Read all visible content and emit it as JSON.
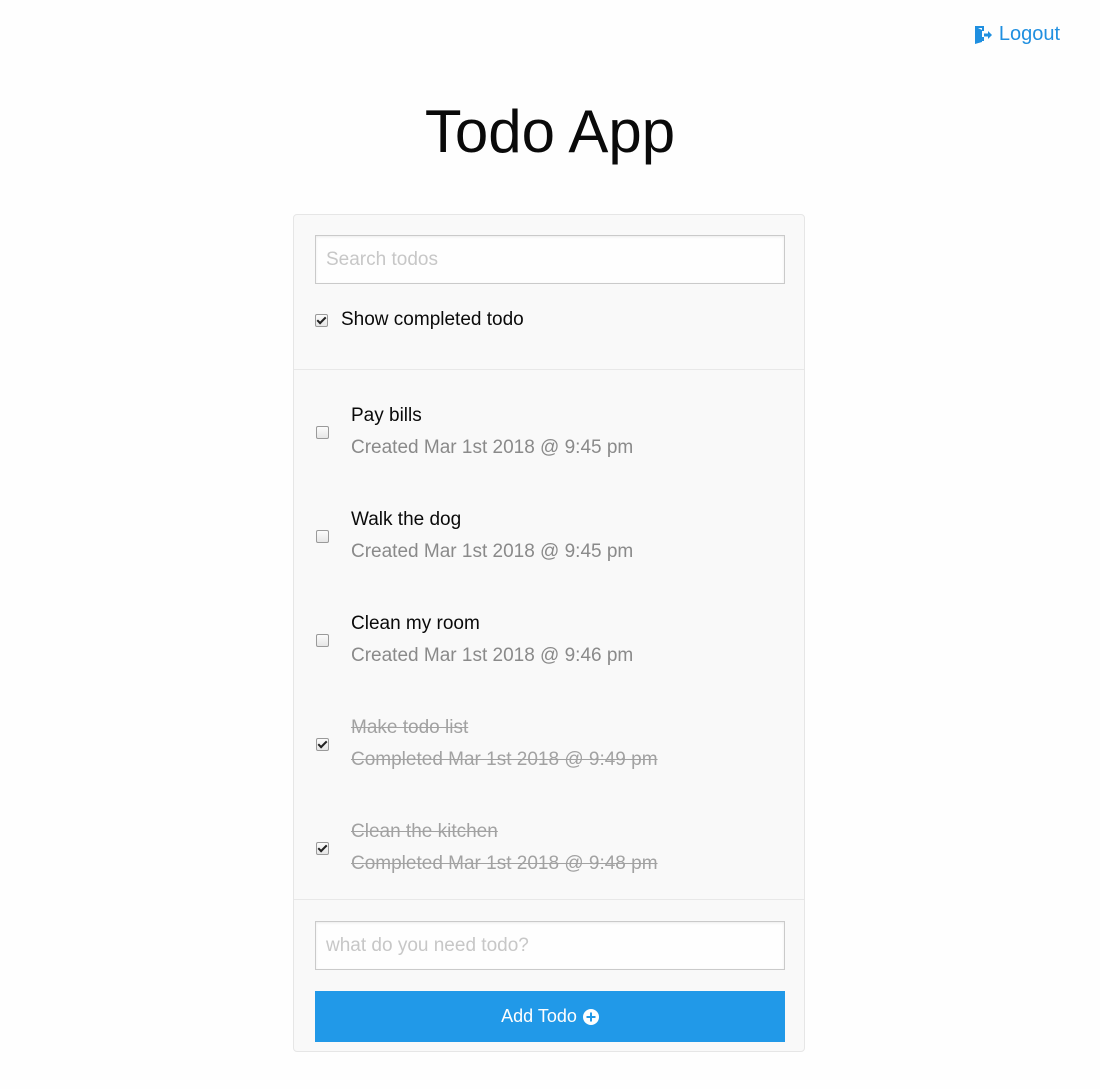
{
  "header": {
    "logout_label": "Logout",
    "logout_icon": "sign-out-icon",
    "accent_color": "#1f8fe0"
  },
  "title": "Todo App",
  "search": {
    "placeholder": "Search todos",
    "value": "",
    "show_completed_label": "Show completed todo",
    "show_completed_checked": true
  },
  "todos": [
    {
      "text": "Pay bills",
      "meta": "Created Mar 1st 2018 @ 9:45 pm",
      "completed": false
    },
    {
      "text": "Walk the dog",
      "meta": "Created Mar 1st 2018 @ 9:45 pm",
      "completed": false
    },
    {
      "text": "Clean my room",
      "meta": "Created Mar 1st 2018 @ 9:46 pm",
      "completed": false
    },
    {
      "text": "Make todo list",
      "meta": "Completed Mar 1st 2018 @ 9:49 pm",
      "completed": true
    },
    {
      "text": "Clean the kitchen",
      "meta": "Completed Mar 1st 2018 @ 9:48 pm",
      "completed": true
    }
  ],
  "add_todo": {
    "placeholder": "what do you need todo?",
    "value": "",
    "button_label": "Add Todo",
    "button_icon": "plus-circle-icon",
    "button_color": "#2199e8"
  }
}
